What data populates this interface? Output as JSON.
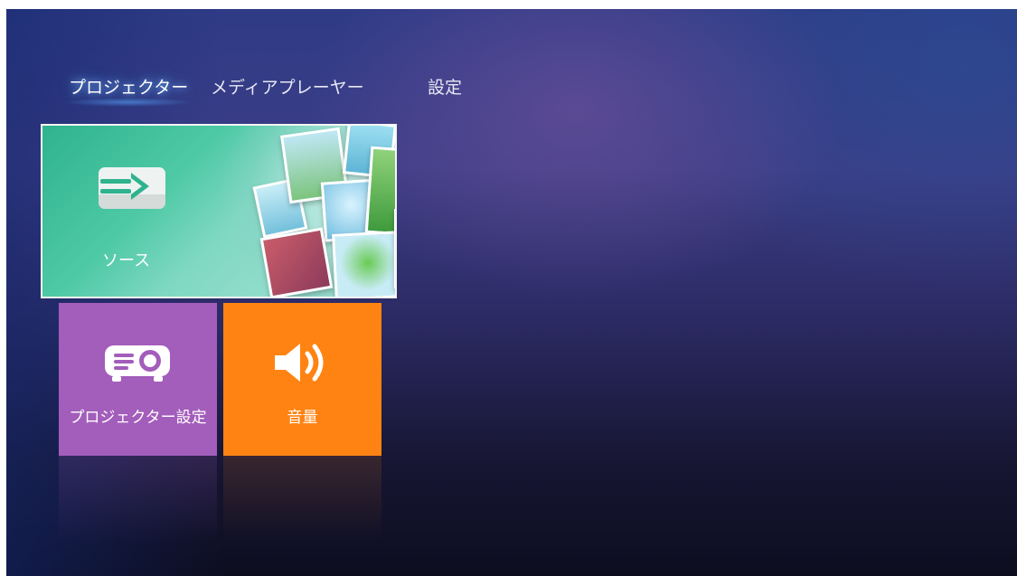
{
  "tabs": [
    {
      "label": "プロジェクター",
      "active": true
    },
    {
      "label": "メディアプレーヤー",
      "active": false
    },
    {
      "label": "設定",
      "active": false
    }
  ],
  "tiles": {
    "source": {
      "label": "ソース",
      "icon": "source-input-icon",
      "color": "#3ebf99"
    },
    "projector_settings": {
      "label": "プロジェクター設定",
      "icon": "projector-icon",
      "color": "#a35dbb"
    },
    "volume": {
      "label": "音量",
      "icon": "speaker-volume-icon",
      "color": "#ff8312"
    }
  },
  "colors": {
    "background_top": "#2f3b86",
    "background_bottom": "#0d0d20",
    "active_tab_glow": "#5aaaff",
    "tile_border": "#f3f6f2"
  }
}
